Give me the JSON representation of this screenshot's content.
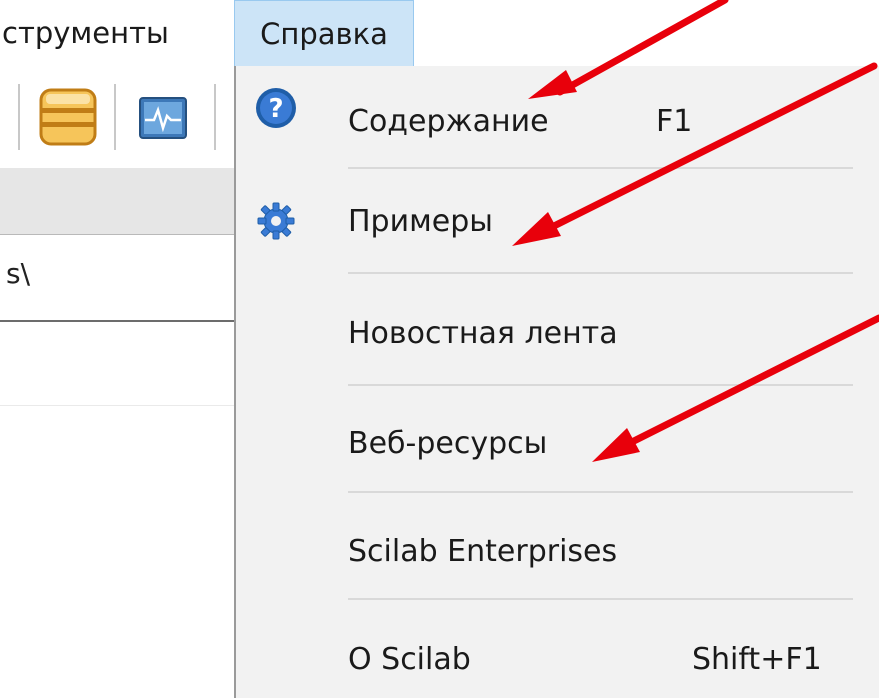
{
  "menubar": {
    "tools_label": "струменты",
    "help_label": "Справка"
  },
  "left_pane": {
    "path_text": "s\\"
  },
  "help_menu": {
    "items": [
      {
        "label": "Содержание",
        "shortcut": "F1",
        "icon": "help-circle-icon"
      },
      {
        "label": "Примеры",
        "shortcut": "",
        "icon": "gear-icon"
      },
      {
        "label": "Новостная лента",
        "shortcut": "",
        "icon": ""
      },
      {
        "label": "Веб-ресурсы",
        "shortcut": "",
        "icon": ""
      },
      {
        "label": "Scilab Enterprises",
        "shortcut": "",
        "icon": ""
      },
      {
        "label": "O Scilab",
        "shortcut": "Shift+F1",
        "icon": ""
      }
    ]
  },
  "colors": {
    "menu_highlight": "#cce4f7",
    "menu_background": "#f2f2f2",
    "help_icon_blue": "#1f5ea8",
    "annotation_arrow": "#e8000b"
  }
}
